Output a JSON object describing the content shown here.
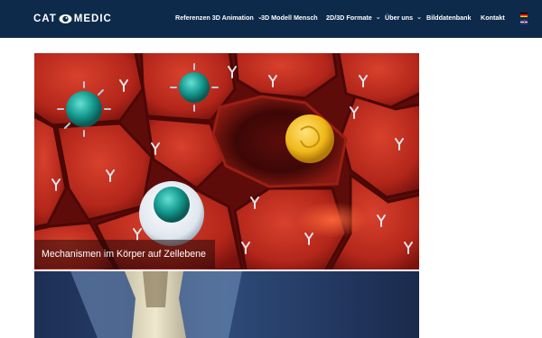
{
  "brand": {
    "logo_left": "CAT",
    "logo_right": "MEDIC"
  },
  "nav": [
    {
      "label": "Referenzen 3D Animation",
      "has_submenu": true
    },
    {
      "label": "3D Modell Mensch",
      "has_submenu": false
    },
    {
      "label": "2D/3D Formate",
      "has_submenu": true
    },
    {
      "label": "Über uns",
      "has_submenu": true
    },
    {
      "label": "Bilddatenbank",
      "has_submenu": false
    },
    {
      "label": "Kontakt",
      "has_submenu": false
    }
  ],
  "languages": [
    "de-flag-icon",
    "en-flag-icon"
  ],
  "hero": {
    "caption": "Mechanismen im Körper auf Zellebene"
  },
  "colors": {
    "header": "#0d2a4a",
    "cell_red": "#b8281c",
    "cell_dark": "#6e0f0c",
    "virus_teal": "#1aa39a",
    "yellow_cell": "#f2c21c",
    "bone_blue": "#2f4d7a"
  }
}
